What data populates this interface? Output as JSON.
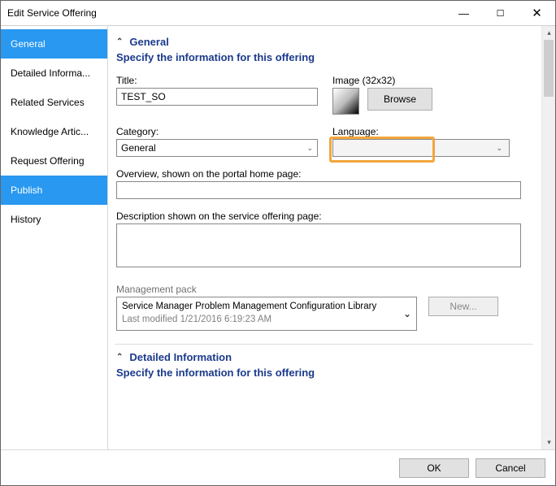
{
  "window": {
    "title": "Edit Service Offering"
  },
  "sidebar": {
    "items": [
      {
        "label": "General",
        "selected": true
      },
      {
        "label": "Detailed Informa..."
      },
      {
        "label": "Related Services"
      },
      {
        "label": "Knowledge Artic..."
      },
      {
        "label": "Request Offering"
      },
      {
        "label": "Publish",
        "selected": true
      },
      {
        "label": "History"
      }
    ]
  },
  "general": {
    "header": "General",
    "subtitle": "Specify the information for this offering",
    "title_lbl": "Title:",
    "title_val": "TEST_SO",
    "image_lbl": "Image (32x32)",
    "browse_btn": "Browse",
    "category_lbl": "Category:",
    "category_val": "General",
    "language_lbl": "Language:",
    "language_val": "",
    "overview_lbl": "Overview, shown on the portal home page:",
    "overview_val": "",
    "description_lbl": "Description shown on the service offering page:",
    "description_val": "",
    "mpack_lbl": "Management pack",
    "mpack_name": "Service Manager Problem Management Configuration Library",
    "mpack_modified": "Last modified  1/21/2016 6:19:23 AM",
    "new_btn": "New..."
  },
  "detailed": {
    "header": "Detailed Information",
    "subtitle": "Specify the information for this offering"
  },
  "footer": {
    "ok": "OK",
    "cancel": "Cancel"
  }
}
